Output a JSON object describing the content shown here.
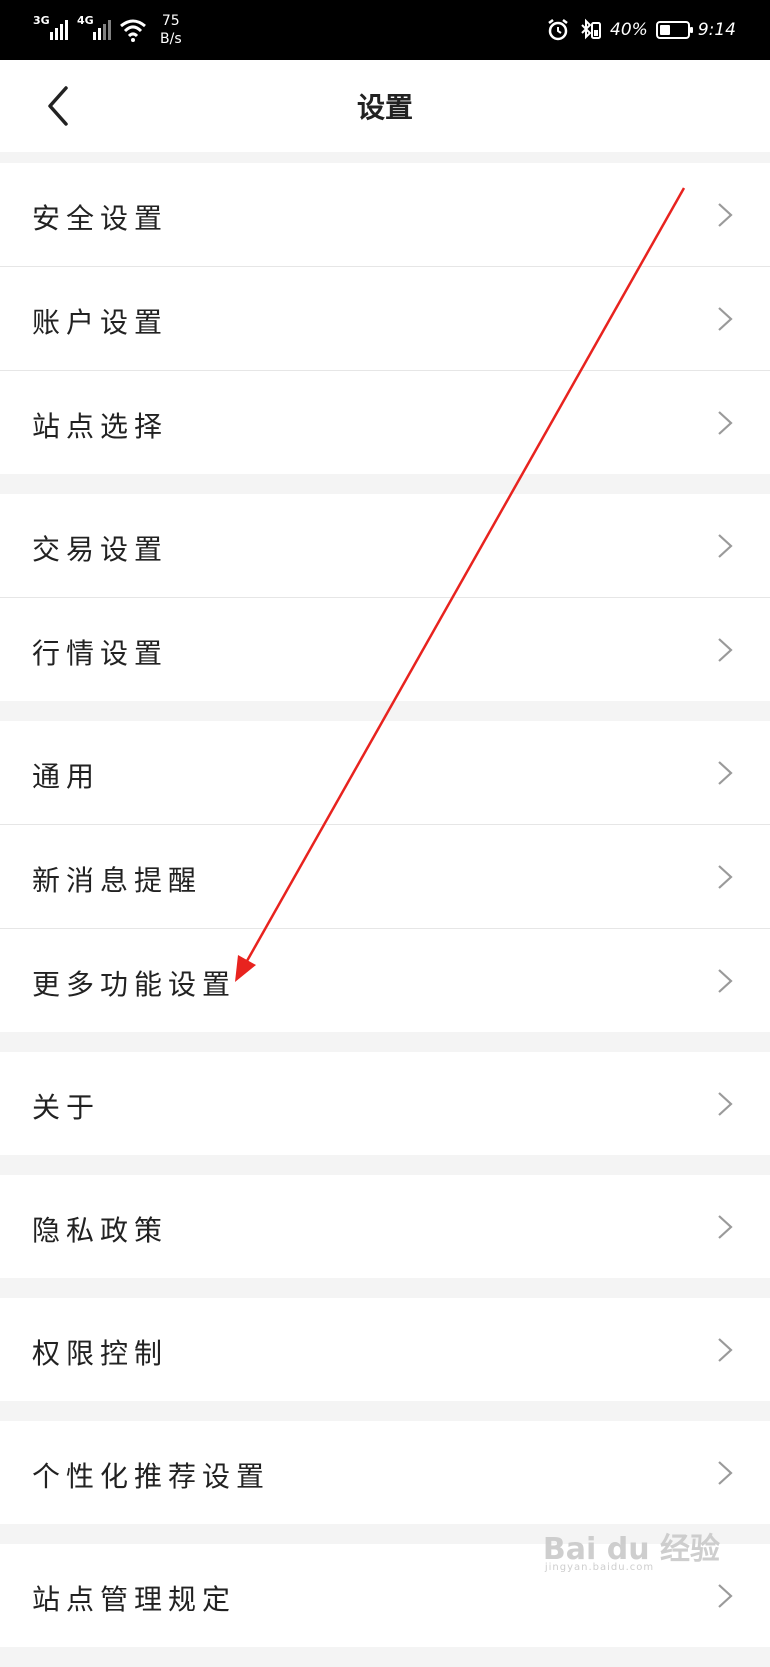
{
  "status_bar": {
    "network1": "3G",
    "network2": "4G",
    "speed_value": "75",
    "speed_unit": "B/s",
    "battery_percent": "40%",
    "battery_level": 0.4,
    "time": "9:14"
  },
  "header": {
    "title": "设置"
  },
  "groups": [
    {
      "items": [
        {
          "label": "安全设置"
        },
        {
          "label": "账户设置"
        },
        {
          "label": "站点选择"
        }
      ]
    },
    {
      "items": [
        {
          "label": "交易设置"
        },
        {
          "label": "行情设置"
        }
      ]
    },
    {
      "items": [
        {
          "label": "通用"
        },
        {
          "label": "新消息提醒"
        },
        {
          "label": "更多功能设置"
        }
      ]
    },
    {
      "items": [
        {
          "label": "关于"
        }
      ]
    },
    {
      "items": [
        {
          "label": "隐私政策"
        }
      ]
    },
    {
      "items": [
        {
          "label": "权限控制"
        }
      ]
    },
    {
      "items": [
        {
          "label": "个性化推荐设置"
        }
      ]
    },
    {
      "items": [
        {
          "label": "站点管理规定"
        }
      ]
    }
  ],
  "watermark": {
    "logo": "Bai du 经验",
    "site": "jingyan.baidu.com"
  },
  "annotation": {
    "arrow_color": "#e8231f"
  }
}
